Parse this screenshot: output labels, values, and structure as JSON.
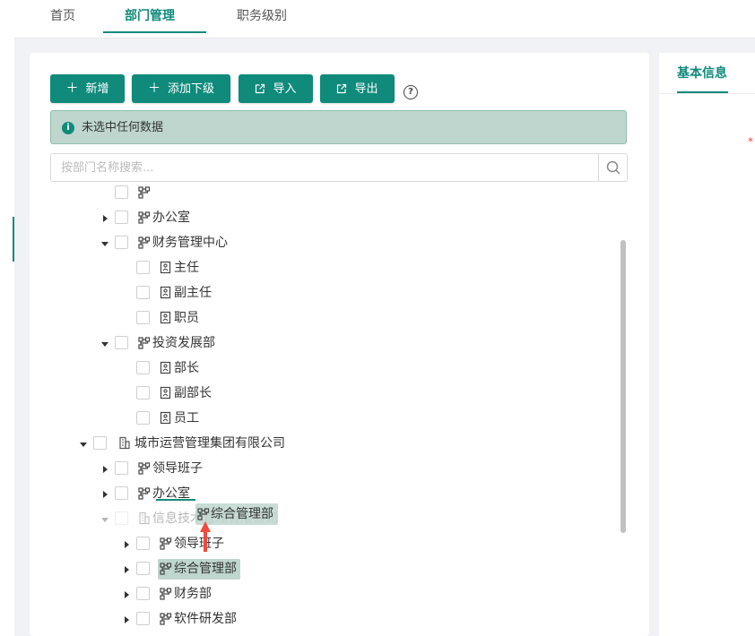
{
  "top_tabs": [
    "首页",
    "部门管理",
    "职务级别"
  ],
  "toolbar": {
    "add_label": "新增",
    "add_child_label": "添加下级",
    "import_label": "导入",
    "export_label": "导出"
  },
  "alert": {
    "text": "未选中任何数据"
  },
  "search": {
    "placeholder": "按部门名称搜索..."
  },
  "tree": {
    "rows": [
      {
        "label": "",
        "level": 2,
        "type": "dept",
        "caret": "none"
      },
      {
        "label": "办公室",
        "level": 2,
        "type": "dept",
        "caret": "collapsed"
      },
      {
        "label": "财务管理中心",
        "level": 2,
        "type": "dept",
        "caret": "expanded"
      },
      {
        "label": "主任",
        "level": 3,
        "type": "position",
        "caret": "none"
      },
      {
        "label": "副主任",
        "level": 3,
        "type": "position",
        "caret": "none"
      },
      {
        "label": "职员",
        "level": 3,
        "type": "position",
        "caret": "none"
      },
      {
        "label": "投资发展部",
        "level": 2,
        "type": "dept",
        "caret": "expanded"
      },
      {
        "label": "部长",
        "level": 3,
        "type": "position",
        "caret": "none"
      },
      {
        "label": "副部长",
        "level": 3,
        "type": "position",
        "caret": "none"
      },
      {
        "label": "员工",
        "level": 3,
        "type": "position",
        "caret": "none"
      },
      {
        "label": "城市运营管理集团有限公司",
        "level": 1,
        "type": "company",
        "caret": "expanded"
      },
      {
        "label": "领导班子",
        "level": 2,
        "type": "dept",
        "caret": "collapsed"
      },
      {
        "label": "办公室",
        "level": 2,
        "type": "dept",
        "caret": "collapsed"
      },
      {
        "label": "信息技术管理有限公司",
        "level": 2,
        "type": "company",
        "caret": "expanded",
        "faded": true
      },
      {
        "label": "领导班子",
        "level": 3,
        "type": "dept",
        "caret": "collapsed"
      },
      {
        "label": "综合管理部",
        "level": 3,
        "type": "dept",
        "caret": "collapsed",
        "highlighted": true
      },
      {
        "label": "财务部",
        "level": 3,
        "type": "dept",
        "caret": "collapsed"
      },
      {
        "label": "软件研发部",
        "level": 3,
        "type": "dept",
        "caret": "collapsed"
      }
    ],
    "drag_ghost_label": "综合管理部"
  },
  "right_panel": {
    "tab_label": "基本信息",
    "required_mark": "*"
  },
  "colors": {
    "accent": "#0f8a7b",
    "alert_bg": "#bfd6cf",
    "drag_arrow": "#f04a3e"
  }
}
